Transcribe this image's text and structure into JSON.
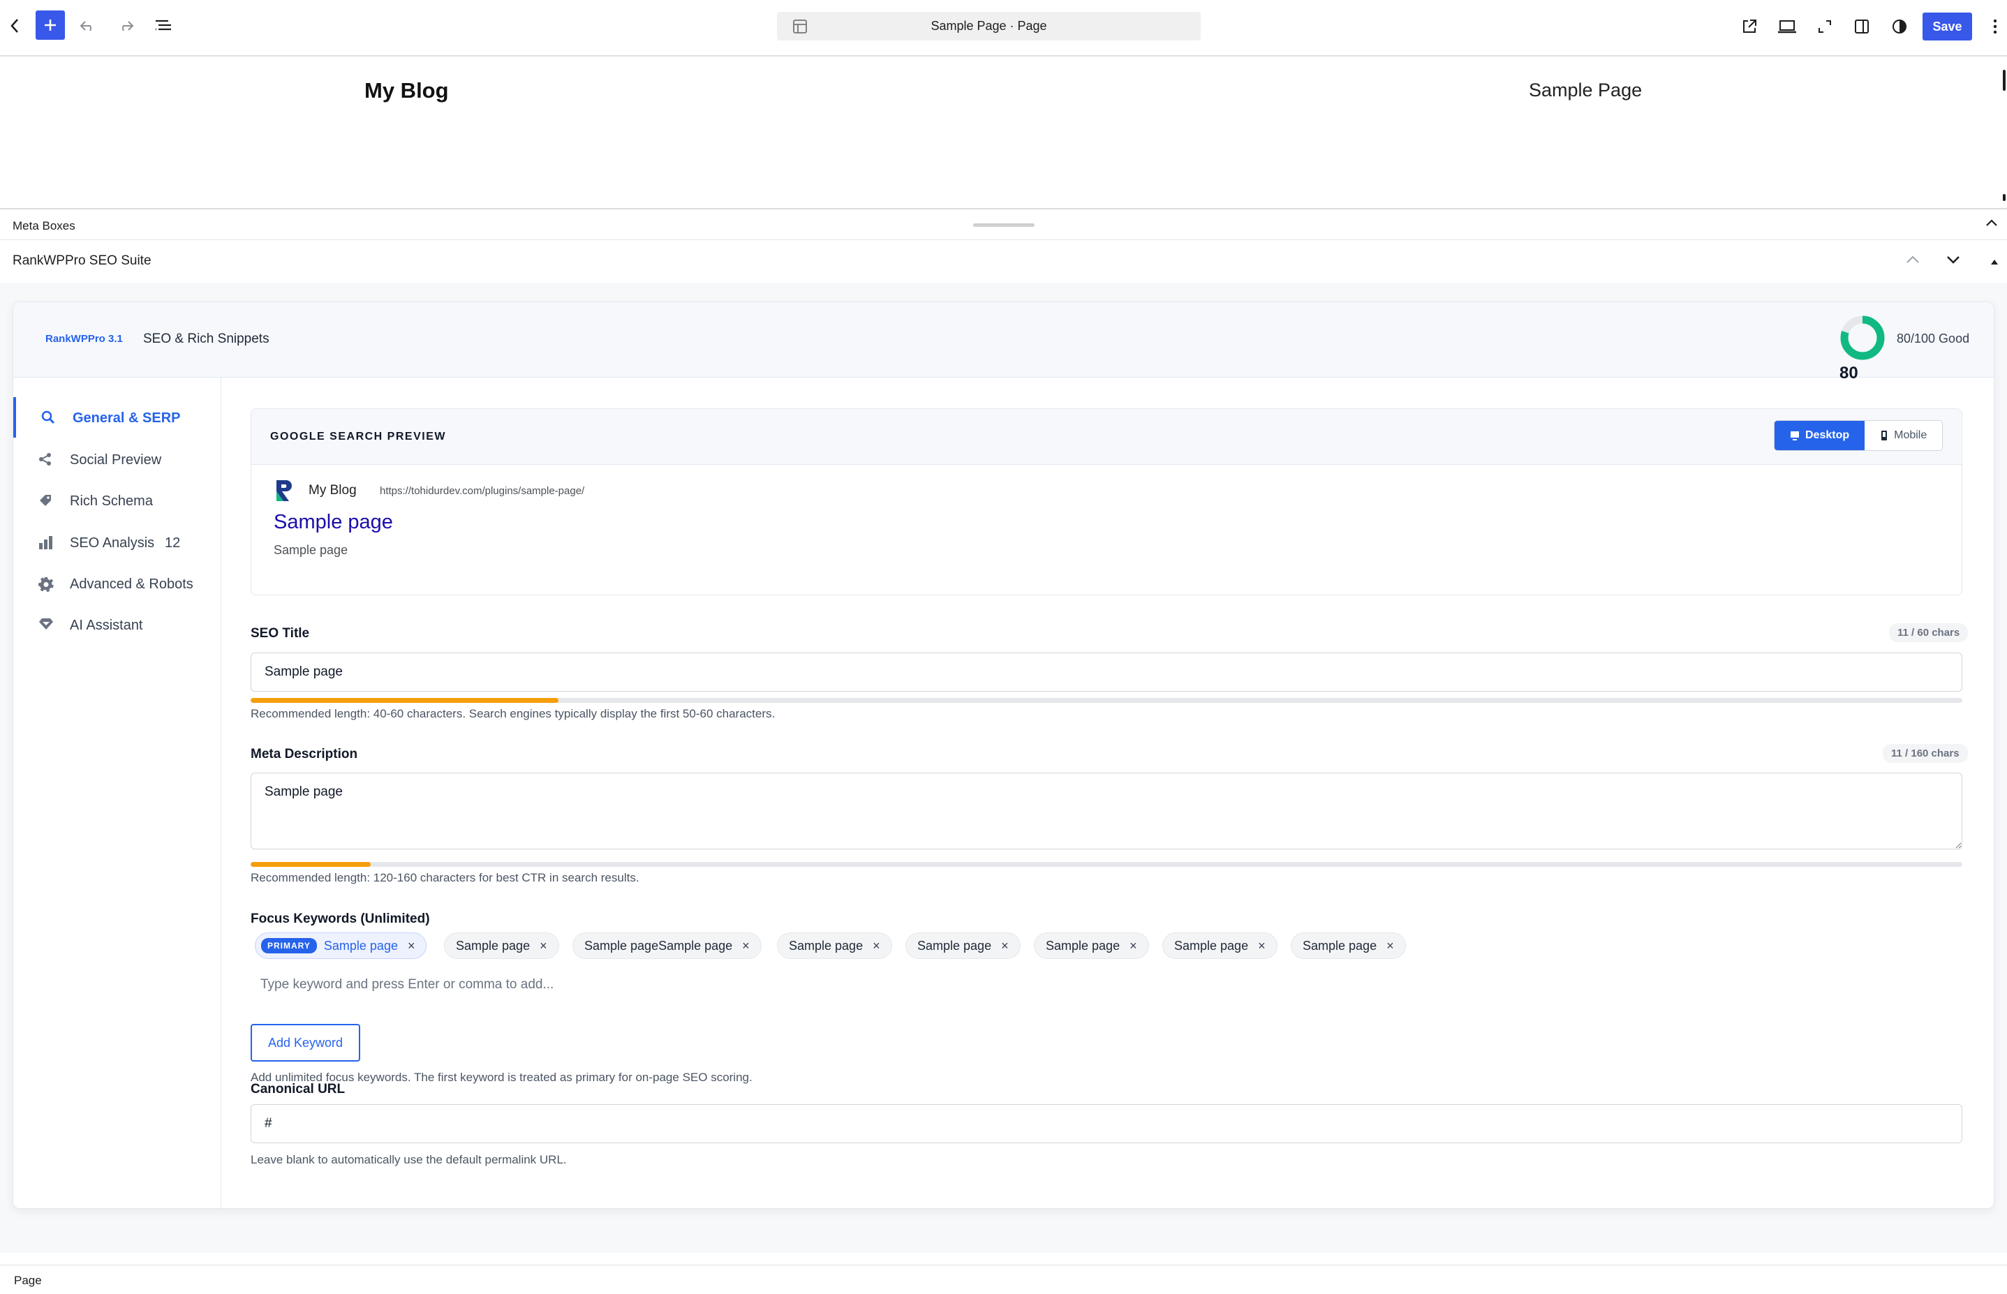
{
  "toolbar": {
    "document_title": "Sample Page · Page",
    "save_label": "Save",
    "icons": [
      "back-icon",
      "add-block-icon",
      "undo-icon",
      "redo-icon",
      "document-overview-icon",
      "external-link-icon",
      "desktop-view-icon",
      "fullscreen-icon",
      "sidebar-toggle-icon",
      "style-toggle-icon",
      "options-menu-icon"
    ]
  },
  "canvas": {
    "site_title": "My Blog",
    "nav_item": "Sample Page"
  },
  "meta_boxes": {
    "label": "Meta Boxes",
    "panel_title": "RankWPPro SEO Suite"
  },
  "plugin": {
    "brand": "RankWPPro 3.1",
    "subtitle": "SEO & Rich Snippets",
    "score": "80",
    "score_value": 80,
    "score_max": 100,
    "score_label": "80/100 Good",
    "score_color": "#10b981"
  },
  "sidebar": {
    "items": [
      {
        "label": "General & SERP",
        "icon": "search-icon",
        "active": true
      },
      {
        "label": "Social Preview",
        "icon": "share-icon",
        "active": false
      },
      {
        "label": "Rich Schema",
        "icon": "tag-icon",
        "active": false
      },
      {
        "label": "SEO Analysis",
        "icon": "bar-chart-icon",
        "active": false,
        "badge": "12"
      },
      {
        "label": "Advanced & Robots",
        "icon": "gear-icon",
        "active": false
      },
      {
        "label": "AI Assistant",
        "icon": "gem-icon",
        "active": false
      }
    ]
  },
  "serp_preview": {
    "heading": "GOOGLE SEARCH PREVIEW",
    "desktop_label": "Desktop",
    "mobile_label": "Mobile",
    "site_name": "My Blog",
    "url": "https://tohidurdev.com/plugins/sample-page/",
    "title": "Sample page",
    "description": "Sample page"
  },
  "seo_title": {
    "label": "SEO Title",
    "count": "11 / 60 chars",
    "value": "Sample page",
    "progress": 0.18,
    "hint": "Recommended length: 40-60 characters. Search engines typically display the first 50-60 characters."
  },
  "meta_description": {
    "label": "Meta Description",
    "count": "11 / 160 chars",
    "value": "Sample page",
    "progress": 0.07,
    "hint": "Recommended length: 120-160 characters for best CTR in search results."
  },
  "focus_keywords": {
    "label": "Focus Keywords (Unlimited)",
    "primary_badge": "PRIMARY",
    "keywords": [
      "Sample page",
      "Sample page",
      "Sample pageSample page",
      "Sample page",
      "Sample page",
      "Sample page",
      "Sample page",
      "Sample page"
    ],
    "placeholder": "Type keyword and press Enter or comma to add...",
    "add_button": "Add Keyword",
    "hint": "Add unlimited focus keywords. The first keyword is treated as primary for on-page SEO scoring."
  },
  "canonical": {
    "label": "Canonical URL",
    "value": "#",
    "hint": "Leave blank to automatically use the default permalink URL."
  },
  "footer": {
    "breadcrumb": "Page"
  },
  "colors": {
    "wp_accent": "#3858e9",
    "plugin_accent": "#2563eb",
    "progress_fill": "#f59e0b",
    "serp_title": "#1a0dab"
  }
}
